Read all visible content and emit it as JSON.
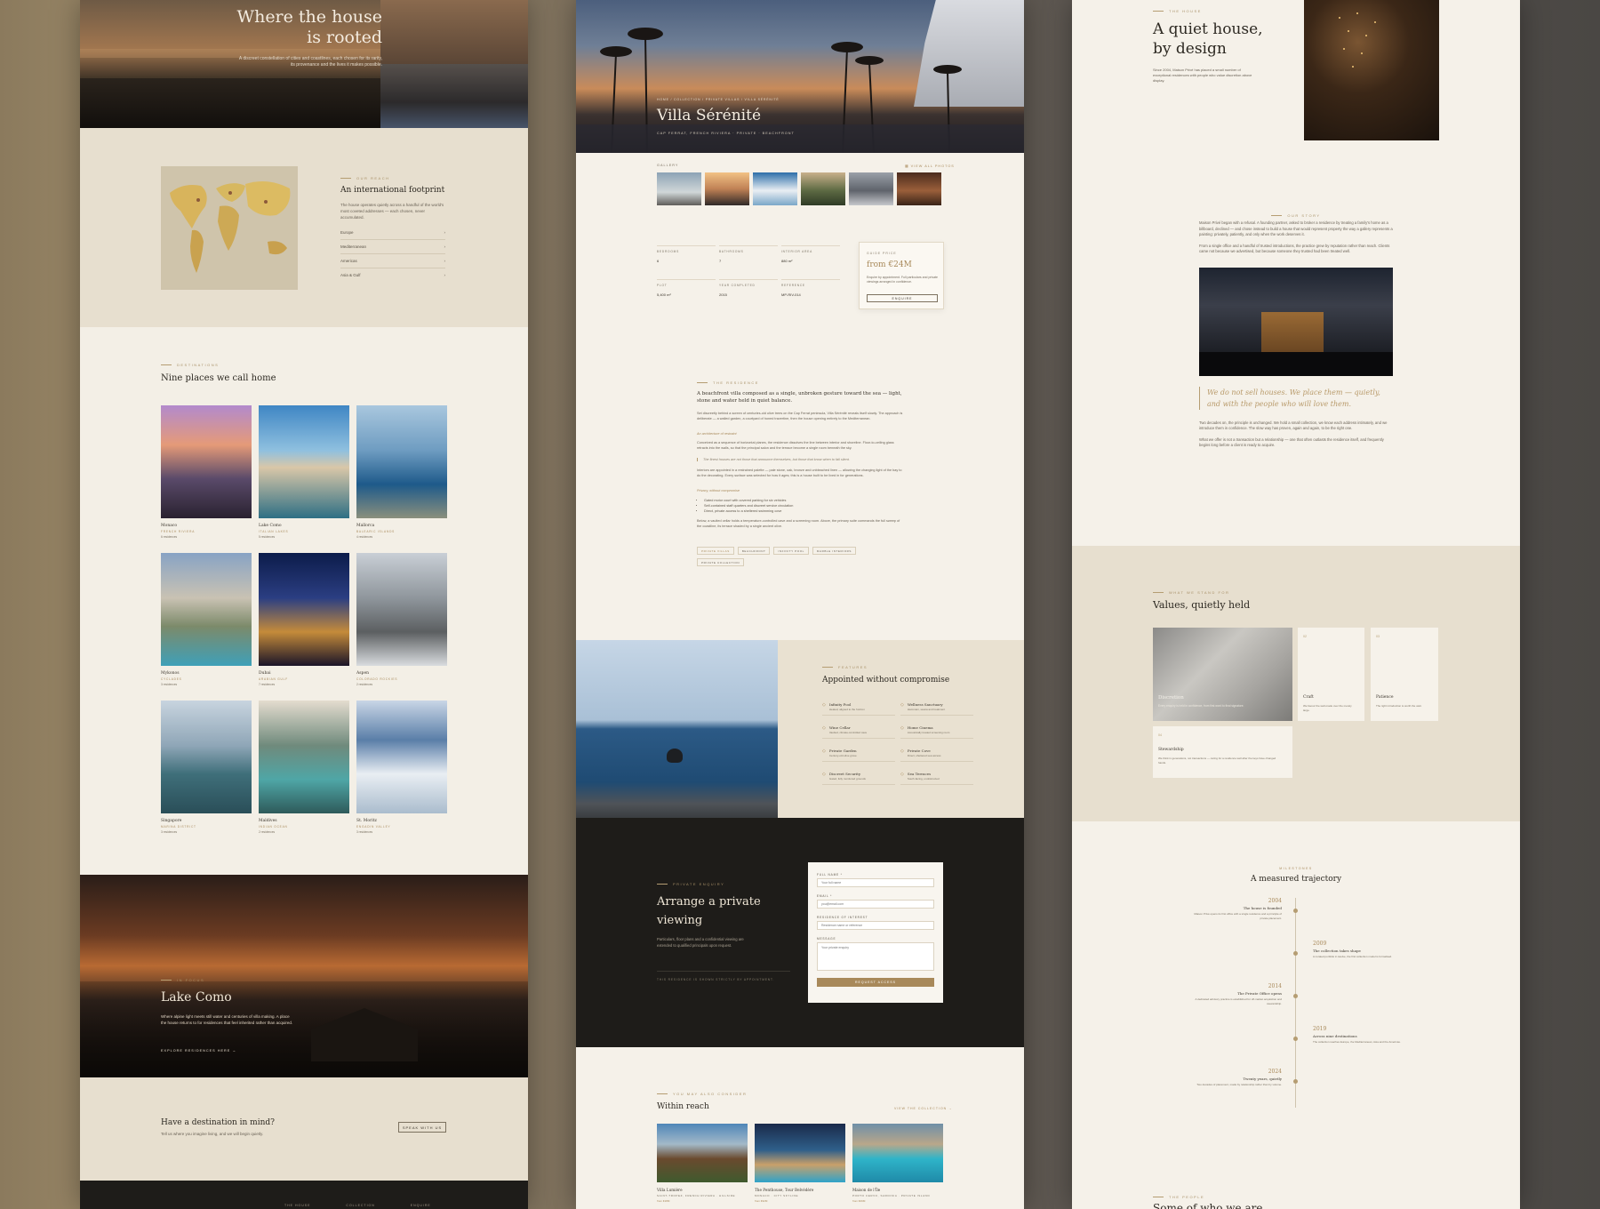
{
  "p1": {
    "hero": {
      "title_l1": "Where the house",
      "title_l2": "is rooted",
      "desc": "A discreet constellation of cities and coastlines, each chosen for its rarity, its provenance and the lives it makes possible."
    },
    "reach": {
      "eyebrow": "Our reach",
      "title": "An international footprint",
      "desc": "The house operates quietly across a handful of the world's most coveted addresses — each chosen, never accumulated.",
      "regions": [
        "Europe",
        "Mediterranean",
        "Americas",
        "Asia & Gulf"
      ]
    },
    "destinations": {
      "eyebrow": "Destinations",
      "title": "Nine places we call home",
      "items": [
        {
          "name": "Monaco",
          "region": "French Riviera",
          "count": "6 residences"
        },
        {
          "name": "Lake Como",
          "region": "Italian Lakes",
          "count": "5 residences"
        },
        {
          "name": "Mallorca",
          "region": "Balearic Islands",
          "count": "4 residences"
        },
        {
          "name": "Mykonos",
          "region": "Cyclades",
          "count": "3 residences"
        },
        {
          "name": "Dubai",
          "region": "Arabian Gulf",
          "count": "7 residences"
        },
        {
          "name": "Aspen",
          "region": "Colorado Rockies",
          "count": "2 residences"
        },
        {
          "name": "Singapore",
          "region": "Marina District",
          "count": "3 residences"
        },
        {
          "name": "Maldives",
          "region": "Indian Ocean",
          "count": "2 residences"
        },
        {
          "name": "St. Moritz",
          "region": "Engadin Valley",
          "count": "3 residences"
        }
      ]
    },
    "focus": {
      "eyebrow": "In focus",
      "title": "Lake Como",
      "desc": "Where alpine light meets still water and centuries of villa making. A place the house returns to for residences that feel inherited rather than acquired.",
      "link": "Explore residences here"
    },
    "cta": {
      "title": "Have a destination in mind?",
      "desc": "Tell us where you imagine living, and we will begin quietly.",
      "button": "Speak with us"
    },
    "footer": [
      "The house",
      "Collection",
      "Enquire"
    ]
  },
  "p2": {
    "breadcrumb": "Home  /  Collection  /  Private Villas  /  Villa Sérénité",
    "title": "Villa Sérénité",
    "subtitle": "Cap Ferrat, French Riviera · Private · Beachfront",
    "gallery_label": "Gallery",
    "gallery_link": "View all photos",
    "specs": [
      {
        "label": "Bedrooms",
        "value": "6"
      },
      {
        "label": "Bathrooms",
        "value": "7"
      },
      {
        "label": "Interior area",
        "value": "880 m²"
      },
      {
        "label": "Plot",
        "value": "5,400 m²"
      },
      {
        "label": "Year completed",
        "value": "2015"
      },
      {
        "label": "Reference",
        "value": "MP-RIV-014"
      }
    ],
    "price": {
      "label": "Guide price",
      "value": "from €24M",
      "note": "Enquire by appointment. Full particulars and private viewings arranged in confidence.",
      "button": "Enquire"
    },
    "residence": {
      "eyebrow": "The residence",
      "lead": "A beachfront villa composed as a single, unbroken gesture toward the sea — light, stone and water held in quiet balance.",
      "p1": "Set discreetly behind a screen of centuries-old olive trees on the Cap Ferrat peninsula, Villa Sérénité reveals itself slowly. The approach is deliberate — a walled garden, a courtyard of honed travertine, then the house opening entirely to the Mediterranean.",
      "h1": "An architecture of restraint",
      "p2": "Conceived as a sequence of horizontal planes, the residence dissolves the line between interior and shoreline. Floor-to-ceiling glass retracts into the walls, so that the principal salon and the terrace become a single room beneath the sky.",
      "quote": "The finest houses are not those that announce themselves, but those that know when to fall silent.",
      "p3": "Interiors are appointed in a restrained palette — pale stone, oak, bronze and unbleached linen — allowing the changing light of the bay to do the decorating. Every surface was selected for how it ages; this is a house built to be lived in for generations.",
      "h2": "Privacy, without compromise",
      "bullets": [
        "Gated motor court with covered parking for six vehicles",
        "Self-contained staff quarters and discreet service circulation",
        "Direct, private access to a sheltered swimming cove"
      ],
      "p4": "Below, a vaulted cellar holds a temperature-controlled cave and a screening room. Above, the primary suite commands the full sweep of the coastline, its terrace shaded by a single ancient olive.",
      "tags": [
        "Private villas",
        "Beachfront",
        "Infinity pool",
        "Marble interiors",
        "Private collection"
      ]
    },
    "features": {
      "eyebrow": "Features",
      "title": "Appointed without compromise",
      "items": [
        {
          "name": "Infinity Pool",
          "desc": "Heated, aligned to the horizon"
        },
        {
          "name": "Wellness Sanctuary",
          "desc": "Hammam, sauna and treatment"
        },
        {
          "name": "Wine Cellar",
          "desc": "Vaulted, climate-controlled cave"
        },
        {
          "name": "Home Cinema",
          "desc": "Acoustically treated screening room"
        },
        {
          "name": "Private Garden",
          "desc": "Century-old olive grove"
        },
        {
          "name": "Private Cove",
          "desc": "Direct, sheltered sea access"
        },
        {
          "name": "Discreet Security",
          "desc": "Gated, fully monitored grounds"
        },
        {
          "name": "Sea Terraces",
          "desc": "South-facing, unobstructed"
        }
      ]
    },
    "viewing": {
      "eyebrow": "Private enquiry",
      "title_l1": "Arrange a private",
      "title_l2": "viewing",
      "desc": "Particulars, floor plans and a confidential viewing are extended to qualified principals upon request.",
      "note": "This residence is shown strictly by appointment.",
      "form": {
        "name_label": "Full name *",
        "name_ph": "Your full name",
        "email_label": "Email *",
        "email_ph": "you@email.com",
        "res_label": "Residence of interest",
        "res_ph": "Residence name or reference",
        "msg_label": "Message",
        "msg_ph": "Your private enquiry",
        "submit": "Request access"
      }
    },
    "also": {
      "eyebrow": "You may also consider",
      "title": "Within reach",
      "link": "View the collection",
      "items": [
        {
          "name": "Villa Lumière",
          "place": "Saint-Tropez, French Riviera · Hillside",
          "price": "from €18M"
        },
        {
          "name": "The Penthouse, Tour Belvédère",
          "place": "Monaco · City Skyline",
          "price": "from €32M"
        },
        {
          "name": "Maison de l'Île",
          "place": "Porto Cervo, Sardinia · Private Island",
          "price": "from €29M"
        }
      ]
    }
  },
  "p3": {
    "intro": {
      "eyebrow": "The house",
      "title_l1": "A quiet house,",
      "title_l2": "by design",
      "desc": "Since 2004, Maison Privé has placed a small number of exceptional residences with people who value discretion above display."
    },
    "story": {
      "eyebrow": "Our story",
      "p1": "Maison Privé began with a refusal. A founding partner, asked to broker a residence by treating a family's home as a billboard, declined — and chose instead to build a house that would represent property the way a gallery represents a painting: privately, patiently, and only when the work deserves it.",
      "p2": "From a single office and a handful of trusted introductions, the practice grew by reputation rather than reach. Clients came not because we advertised, but because someone they trusted had been treated well.",
      "quote": "We do not sell houses. We place them — quietly, and with the people who will love them.",
      "p3": "Two decades on, the principle is unchanged. We hold a small collection, we know each address intimately, and we introduce them in confidence. The slow way has proven, again and again, to be the right one.",
      "p4": "What we offer is not a transaction but a relationship — one that often outlasts the residence itself, and frequently begins long before a client is ready to acquire."
    },
    "values": {
      "eyebrow": "What we stand for",
      "title": "Values, quietly held",
      "items": [
        {
          "num": "01",
          "name": "Discretion",
          "desc": "Every enquiry is held in confidence, from first word to final signature."
        },
        {
          "num": "02",
          "name": "Craft",
          "desc": "We favour the well-made over the merely large."
        },
        {
          "num": "03",
          "name": "Patience",
          "desc": "The right introduction is worth the wait."
        },
        {
          "num": "04",
          "name": "Stewardship",
          "desc": "We think in generations, not transactions — caring for a residence well after the keys have changed hands."
        }
      ]
    },
    "milestones": {
      "eyebrow": "Milestones",
      "title": "A measured trajectory",
      "items": [
        {
          "year": "2004",
          "name": "The house is founded",
          "desc": "Maison Privé opens its first office with a single residence and a principle of private placement."
        },
        {
          "year": "2009",
          "name": "The collection takes shape",
          "desc": "A curated portfolio in twelve, the first collection model is formalised."
        },
        {
          "year": "2014",
          "name": "The Private Office opens",
          "desc": "A dedicated advisory practice is established for off-market acquisition and stewardship."
        },
        {
          "year": "2019",
          "name": "Across nine destinations",
          "desc": "The collection reaches Europe, the Mediterranean, Asia and the Americas."
        },
        {
          "year": "2024",
          "name": "Twenty years, quietly",
          "desc": "Two decades of placement, made by relationship rather than by volume."
        }
      ]
    },
    "footer_eyebrow": "The people",
    "footer_title": "Some of who we are"
  },
  "colors": {
    "cream": "#f5f1e9",
    "sand": "#e7dfcf",
    "gold": "#a8895a",
    "dark": "#1e1c19"
  }
}
